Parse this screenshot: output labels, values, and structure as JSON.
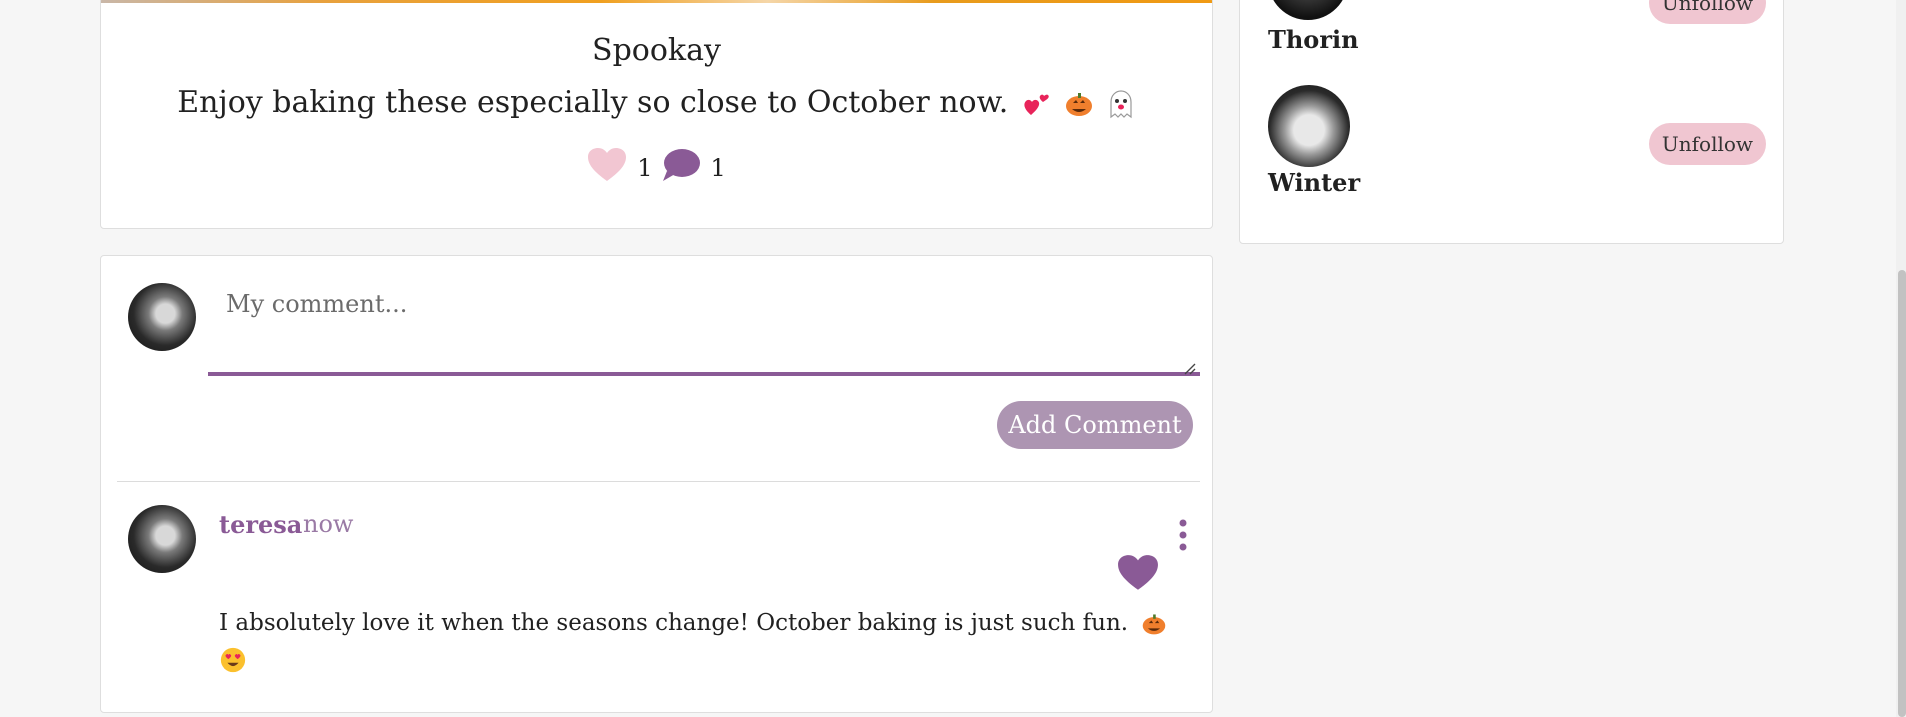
{
  "post": {
    "title": "Spookay",
    "body": "Enjoy baking these especially so close to October now.",
    "emojis": [
      "two-hearts",
      "jack-o-lantern",
      "ghost"
    ],
    "like_count": "1",
    "comment_count": "1"
  },
  "comment_form": {
    "placeholder": "My comment...",
    "submit_label": "Add Comment"
  },
  "comments": [
    {
      "author": "teresa",
      "time": "now",
      "text": "I absolutely love it when the seasons change! October baking is just such fun.",
      "emojis": [
        "jack-o-lantern",
        "heart-eyes"
      ]
    }
  ],
  "sidebar": {
    "users": [
      {
        "name": "Thorin",
        "button": "Unfollow"
      },
      {
        "name": "Winter",
        "button": "Unfollow"
      }
    ]
  },
  "colors": {
    "accent": "#8a5a96",
    "button_muted": "#ad95b2",
    "unfollow_bg": "#f0c6d1",
    "like_pink": "#f2c6d2"
  }
}
